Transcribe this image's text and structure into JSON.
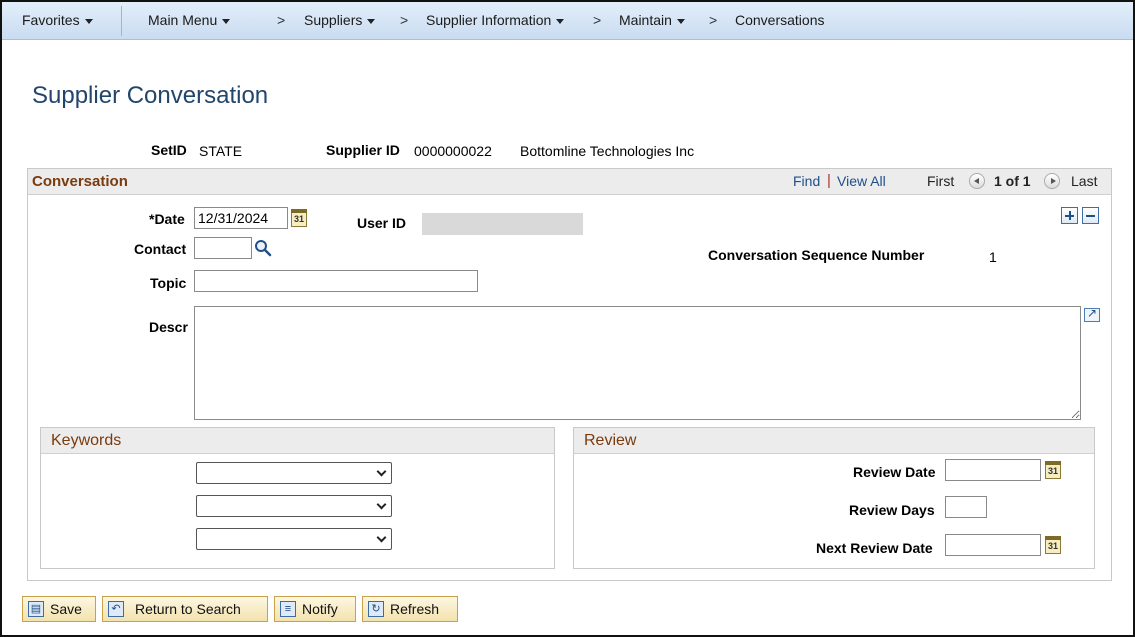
{
  "nav": {
    "favorites": "Favorites",
    "main_menu": "Main Menu",
    "suppliers": "Suppliers",
    "supplier_information": "Supplier Information",
    "maintain": "Maintain",
    "conversations": "Conversations",
    "separator": ">"
  },
  "page": {
    "title": "Supplier Conversation"
  },
  "header": {
    "setid_label": "SetID",
    "setid_value": "STATE",
    "supplier_id_label": "Supplier ID",
    "supplier_id_value": "0000000022",
    "supplier_name": "Bottomline Technologies Inc"
  },
  "conversation": {
    "title": "Conversation",
    "find": "Find",
    "pipe": "|",
    "view_all": "View All",
    "first": "First",
    "page_indicator": "1 of 1",
    "last": "Last",
    "date_label": "*Date",
    "date_value": "12/31/2024",
    "user_id_label": "User ID",
    "contact_label": "Contact",
    "contact_value": "",
    "topic_label": "Topic",
    "topic_value": "",
    "descr_label": "Descr",
    "descr_value": "",
    "seq_label": "Conversation Sequence Number",
    "seq_value": "1",
    "calendar_icon_text": "31"
  },
  "keywords": {
    "title": "Keywords",
    "selects": [
      "",
      "",
      ""
    ]
  },
  "review": {
    "title": "Review",
    "review_date_label": "Review Date",
    "review_date_value": "",
    "review_days_label": "Review Days",
    "review_days_value": "",
    "next_review_date_label": "Next Review Date",
    "next_review_date_value": ""
  },
  "toolbar": {
    "save": "Save",
    "return_to_search": "Return to Search",
    "notify": "Notify",
    "refresh": "Refresh"
  },
  "colors": {
    "title_blue": "#22466b",
    "section_brown": "#7a3b0e",
    "button_gold": "#f3e2ad"
  }
}
